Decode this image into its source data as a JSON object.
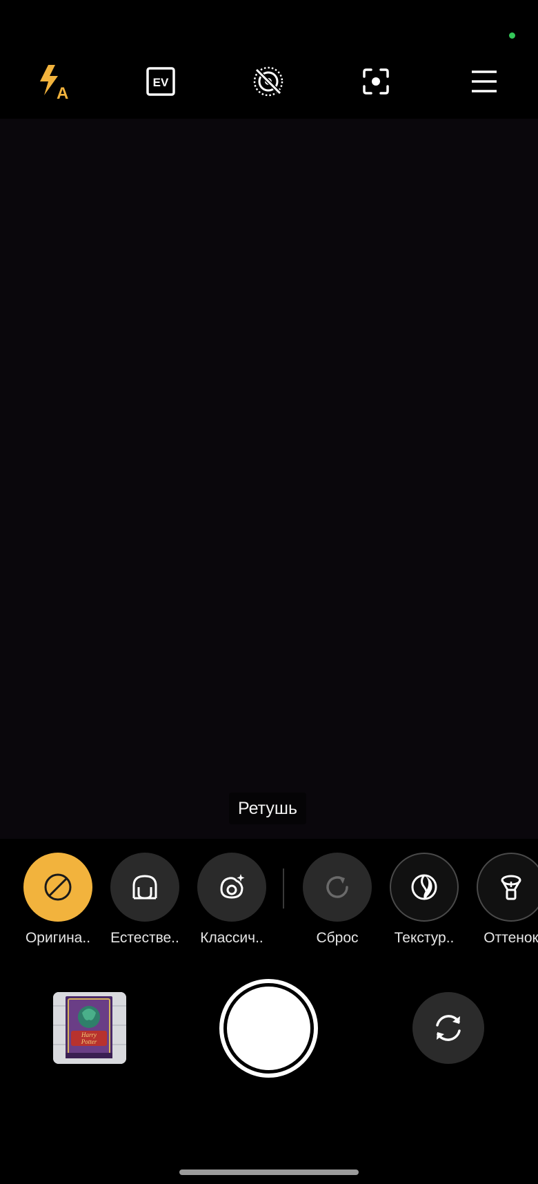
{
  "top_bar": {
    "flash_auto_letter": "A",
    "ev_label": "EV",
    "icons": [
      "flash-auto-icon",
      "exposure-ev-icon",
      "live-photo-off-icon",
      "focus-target-icon",
      "menu-icon"
    ]
  },
  "mode": {
    "label": "Ретушь"
  },
  "filters": [
    {
      "label": "Оригина..",
      "icon": "none-icon",
      "selected": true
    },
    {
      "label": "Естестве..",
      "icon": "face-shape-icon",
      "selected": false
    },
    {
      "label": "Классич..",
      "icon": "classic-beauty-icon",
      "selected": false
    },
    {
      "label": "Сброс",
      "icon": "reset-icon",
      "selected": false
    },
    {
      "label": "Текстур..",
      "icon": "texture-icon",
      "selected": false
    },
    {
      "label": "Оттенок",
      "icon": "tone-lamp-icon",
      "selected": false
    }
  ],
  "colors": {
    "accent": "#f2b33d",
    "status_dot": "#34c759",
    "viewfinder": "#0a070c"
  },
  "gallery_thumbnail": {
    "title_line1": "Harry",
    "title_line2": "Potter"
  }
}
